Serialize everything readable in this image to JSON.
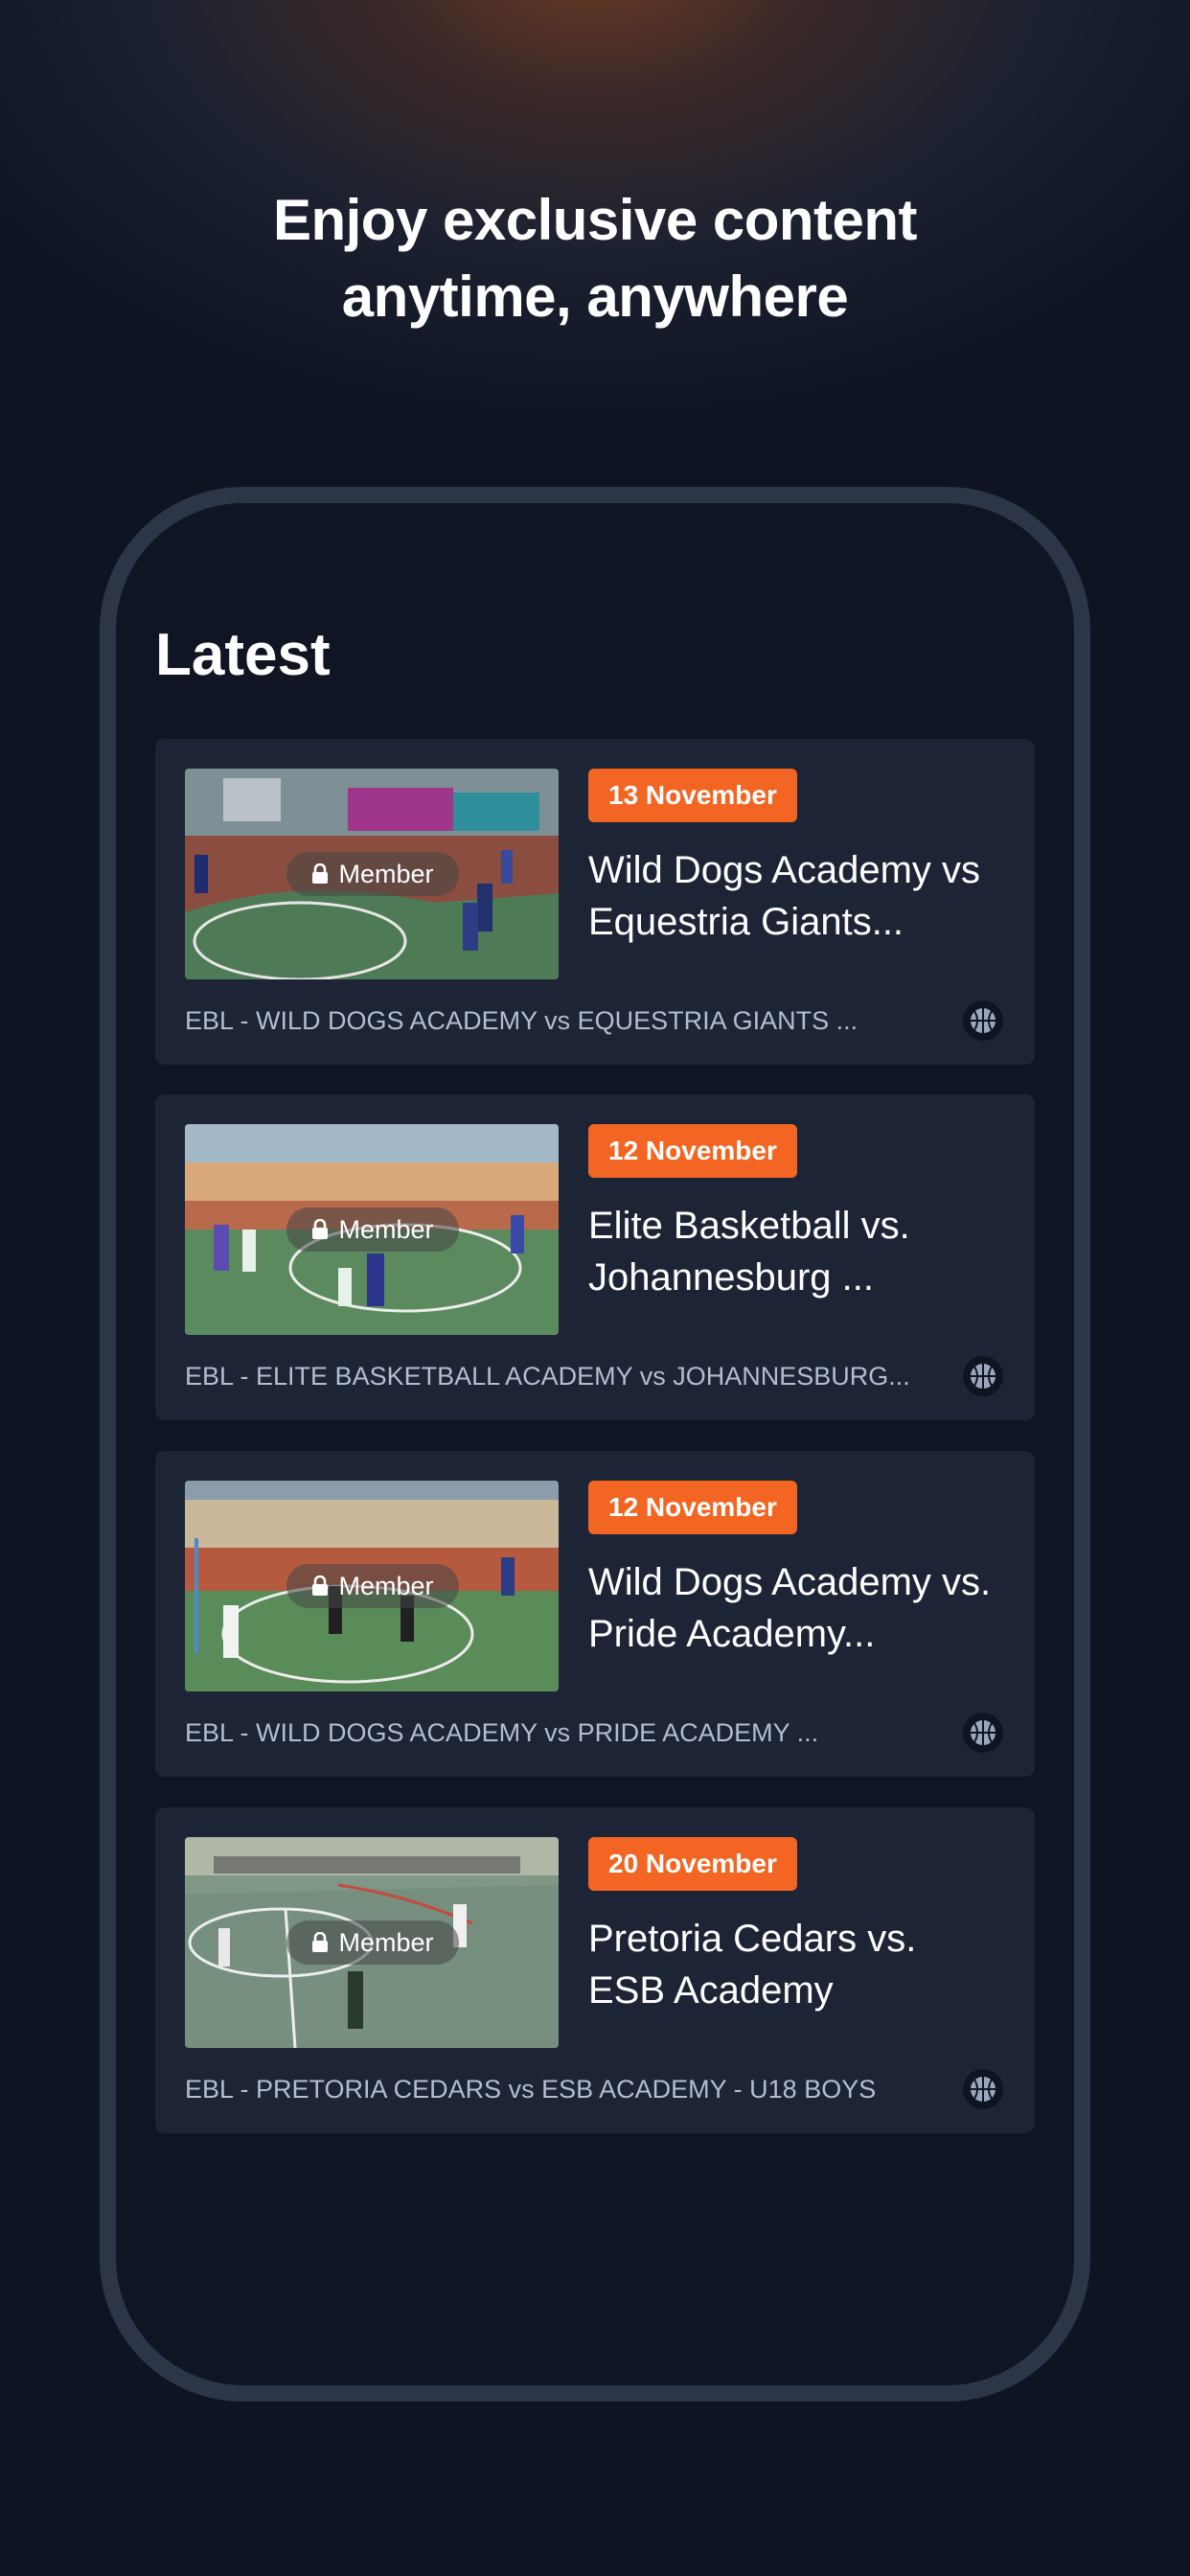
{
  "headline": {
    "line1": "Enjoy exclusive content",
    "line2": "anytime, anywhere"
  },
  "section": {
    "title": "Latest"
  },
  "member_label": "Member",
  "icons": {
    "lock": "lock-icon",
    "sport": "basketball-icon"
  },
  "colors": {
    "background": "#0e1421",
    "card": "#1c2435",
    "accent": "#f26522",
    "subtitle": "#b3bdd3",
    "phone_frame": "#2d3548"
  },
  "cards": [
    {
      "date": "13 November",
      "title_line1": "Wild Dogs Academy vs",
      "title_line2": "Equestria Giants...",
      "subtitle": "EBL - WILD DOGS ACADEMY vs EQUESTRIA GIANTS ..."
    },
    {
      "date": "12 November",
      "title_line1": "Elite Basketball  vs.",
      "title_line2": "Johannesburg ...",
      "subtitle": "EBL - ELITE BASKETBALL ACADEMY vs JOHANNESBURG..."
    },
    {
      "date": "12 November",
      "title_line1": "Wild Dogs Academy vs.",
      "title_line2": "Pride Academy...",
      "subtitle": "EBL - WILD DOGS ACADEMY vs PRIDE ACADEMY ..."
    },
    {
      "date": "20 November",
      "title_line1": "Pretoria Cedars vs.",
      "title_line2": "ESB Academy",
      "subtitle": "EBL - PRETORIA CEDARS vs ESB ACADEMY - U18 BOYS"
    }
  ]
}
